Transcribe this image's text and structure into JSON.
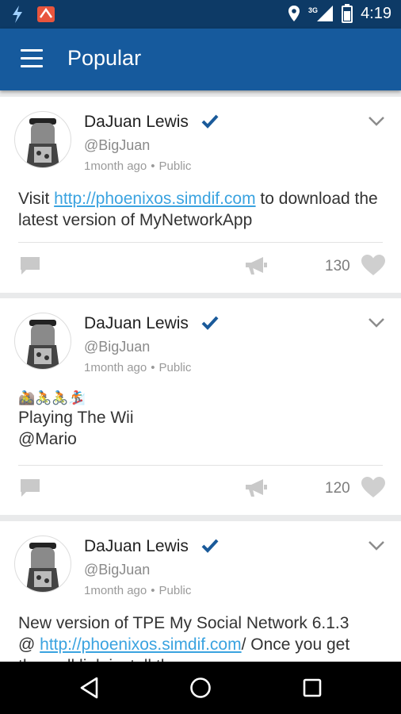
{
  "status_bar": {
    "time": "4:19",
    "network": "3G"
  },
  "app_bar": {
    "title": "Popular"
  },
  "posts": [
    {
      "name": "DaJuan Lewis",
      "handle": "@BigJuan",
      "time": "1month ago",
      "visibility": "Public",
      "text_before": "Visit ",
      "link": "http://phoenixos.simdif.com",
      "text_after": " to download the latest version of MyNetworkApp",
      "likes": "130"
    },
    {
      "name": "DaJuan Lewis",
      "handle": "@BigJuan",
      "time": "1month ago",
      "visibility": "Public",
      "emojis": "🚵🚴🚴🏂",
      "line1": "Playing The Wii",
      "line2": "@Mario",
      "likes": "120"
    },
    {
      "name": "DaJuan Lewis",
      "handle": "@BigJuan",
      "time": "1month ago",
      "visibility": "Public",
      "line1": "New version of TPE My Social Network 6.1.3",
      "line2_before": "@ ",
      "link": "http://phoenixos.simdif.com",
      "line2_after": "/ Once you get",
      "line3": "the well link install the new ver..."
    }
  ],
  "colors": {
    "status_bar": "#0d3a66",
    "app_bar": "#165a9d",
    "link": "#3aa3e0",
    "verified": "#1a5a9a"
  },
  "icons": [
    "menu-icon",
    "verified-icon",
    "chevron-down-icon",
    "comment-icon",
    "megaphone-icon",
    "heart-icon",
    "back-icon",
    "home-icon",
    "recents-icon"
  ]
}
